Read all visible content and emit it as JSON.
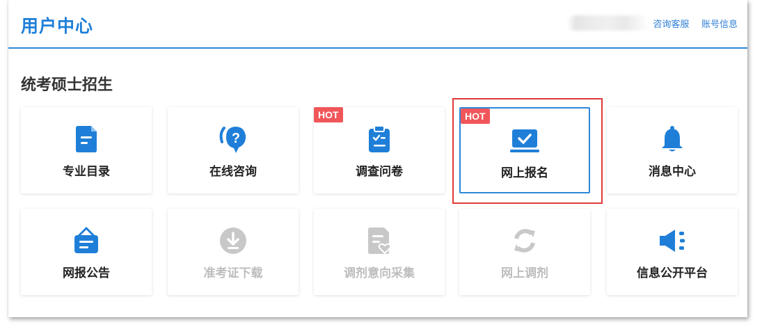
{
  "header": {
    "title": "用户中心",
    "links": [
      "咨询客服",
      "账号信息"
    ]
  },
  "section": {
    "title": "统考硕士招生"
  },
  "cards": [
    {
      "label": "专业目录",
      "icon": "document-icon",
      "hot": "",
      "disabled": false
    },
    {
      "label": "在线咨询",
      "icon": "question-chat-icon",
      "hot": "",
      "disabled": false
    },
    {
      "label": "调查问卷",
      "icon": "clipboard-checklist-icon",
      "hot": "HOT",
      "disabled": false
    },
    {
      "label": "网上报名",
      "icon": "laptop-check-icon",
      "hot": "HOT",
      "disabled": false,
      "selected": true
    },
    {
      "label": "消息中心",
      "icon": "bell-icon",
      "hot": "",
      "disabled": false
    },
    {
      "label": "网报公告",
      "icon": "notice-board-icon",
      "hot": "",
      "disabled": false
    },
    {
      "label": "准考证下载",
      "icon": "download-circle-icon",
      "hot": "",
      "disabled": true
    },
    {
      "label": "调剂意向采集",
      "icon": "form-heart-icon",
      "hot": "",
      "disabled": true
    },
    {
      "label": "网上调剂",
      "icon": "refresh-icon",
      "hot": "",
      "disabled": true
    },
    {
      "label": "信息公开平台",
      "icon": "megaphone-icon",
      "hot": "",
      "disabled": false
    }
  ],
  "colors": {
    "accent": "#1f7fd8",
    "hot_badge": "#f0565a",
    "highlight": "#e03a3a",
    "disabled": "#c8c8c8"
  }
}
